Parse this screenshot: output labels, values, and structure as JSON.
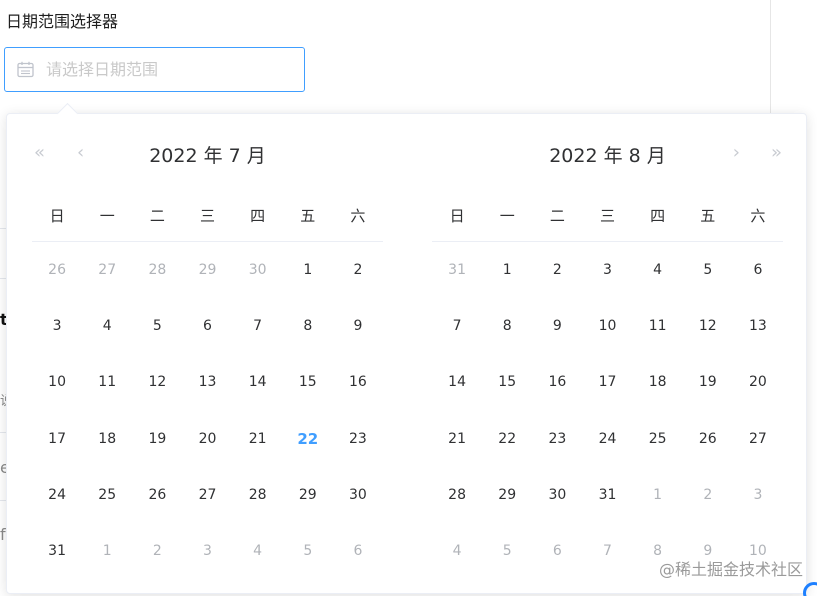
{
  "page": {
    "title": "日期范围选择器",
    "bg_fragments": [
      "t",
      "说",
      "e",
      "fa"
    ]
  },
  "input": {
    "placeholder": "请选择日期范围",
    "value": ""
  },
  "icons": {
    "calendar": "calendar-icon",
    "prev_year": "«",
    "prev_month": "‹",
    "next_month": "›",
    "next_year": "»"
  },
  "weekdays": [
    "日",
    "一",
    "二",
    "三",
    "四",
    "五",
    "六"
  ],
  "calendars": [
    {
      "title": "2022 年 7 月",
      "days": [
        {
          "d": "26",
          "t": "prev"
        },
        {
          "d": "27",
          "t": "prev"
        },
        {
          "d": "28",
          "t": "prev"
        },
        {
          "d": "29",
          "t": "prev"
        },
        {
          "d": "30",
          "t": "prev"
        },
        {
          "d": "1",
          "t": "cur"
        },
        {
          "d": "2",
          "t": "cur"
        },
        {
          "d": "3",
          "t": "cur"
        },
        {
          "d": "4",
          "t": "cur"
        },
        {
          "d": "5",
          "t": "cur"
        },
        {
          "d": "6",
          "t": "cur"
        },
        {
          "d": "7",
          "t": "cur"
        },
        {
          "d": "8",
          "t": "cur"
        },
        {
          "d": "9",
          "t": "cur"
        },
        {
          "d": "10",
          "t": "cur"
        },
        {
          "d": "11",
          "t": "cur"
        },
        {
          "d": "12",
          "t": "cur"
        },
        {
          "d": "13",
          "t": "cur"
        },
        {
          "d": "14",
          "t": "cur"
        },
        {
          "d": "15",
          "t": "cur"
        },
        {
          "d": "16",
          "t": "cur"
        },
        {
          "d": "17",
          "t": "cur"
        },
        {
          "d": "18",
          "t": "cur"
        },
        {
          "d": "19",
          "t": "cur"
        },
        {
          "d": "20",
          "t": "cur"
        },
        {
          "d": "21",
          "t": "cur"
        },
        {
          "d": "22",
          "t": "today"
        },
        {
          "d": "23",
          "t": "cur"
        },
        {
          "d": "24",
          "t": "cur"
        },
        {
          "d": "25",
          "t": "cur"
        },
        {
          "d": "26",
          "t": "cur"
        },
        {
          "d": "27",
          "t": "cur"
        },
        {
          "d": "28",
          "t": "cur"
        },
        {
          "d": "29",
          "t": "cur"
        },
        {
          "d": "30",
          "t": "cur"
        },
        {
          "d": "31",
          "t": "cur"
        },
        {
          "d": "1",
          "t": "next"
        },
        {
          "d": "2",
          "t": "next"
        },
        {
          "d": "3",
          "t": "next"
        },
        {
          "d": "4",
          "t": "next"
        },
        {
          "d": "5",
          "t": "next"
        },
        {
          "d": "6",
          "t": "next"
        }
      ]
    },
    {
      "title": "2022 年 8 月",
      "days": [
        {
          "d": "31",
          "t": "prev"
        },
        {
          "d": "1",
          "t": "cur"
        },
        {
          "d": "2",
          "t": "cur"
        },
        {
          "d": "3",
          "t": "cur"
        },
        {
          "d": "4",
          "t": "cur"
        },
        {
          "d": "5",
          "t": "cur"
        },
        {
          "d": "6",
          "t": "cur"
        },
        {
          "d": "7",
          "t": "cur"
        },
        {
          "d": "8",
          "t": "cur"
        },
        {
          "d": "9",
          "t": "cur"
        },
        {
          "d": "10",
          "t": "cur"
        },
        {
          "d": "11",
          "t": "cur"
        },
        {
          "d": "12",
          "t": "cur"
        },
        {
          "d": "13",
          "t": "cur"
        },
        {
          "d": "14",
          "t": "cur"
        },
        {
          "d": "15",
          "t": "cur"
        },
        {
          "d": "16",
          "t": "cur"
        },
        {
          "d": "17",
          "t": "cur"
        },
        {
          "d": "18",
          "t": "cur"
        },
        {
          "d": "19",
          "t": "cur"
        },
        {
          "d": "20",
          "t": "cur"
        },
        {
          "d": "21",
          "t": "cur"
        },
        {
          "d": "22",
          "t": "cur"
        },
        {
          "d": "23",
          "t": "cur"
        },
        {
          "d": "24",
          "t": "cur"
        },
        {
          "d": "25",
          "t": "cur"
        },
        {
          "d": "26",
          "t": "cur"
        },
        {
          "d": "27",
          "t": "cur"
        },
        {
          "d": "28",
          "t": "cur"
        },
        {
          "d": "29",
          "t": "cur"
        },
        {
          "d": "30",
          "t": "cur"
        },
        {
          "d": "31",
          "t": "cur"
        },
        {
          "d": "1",
          "t": "next"
        },
        {
          "d": "2",
          "t": "next"
        },
        {
          "d": "3",
          "t": "next"
        },
        {
          "d": "4",
          "t": "next"
        },
        {
          "d": "5",
          "t": "next"
        },
        {
          "d": "6",
          "t": "next"
        },
        {
          "d": "7",
          "t": "next"
        },
        {
          "d": "8",
          "t": "next"
        },
        {
          "d": "9",
          "t": "next"
        },
        {
          "d": "10",
          "t": "next"
        }
      ]
    }
  ],
  "watermark": "@稀土掘金技术社区",
  "colors": {
    "accent": "#409eff",
    "muted_day": "#b0b3b8",
    "text": "#303133"
  }
}
